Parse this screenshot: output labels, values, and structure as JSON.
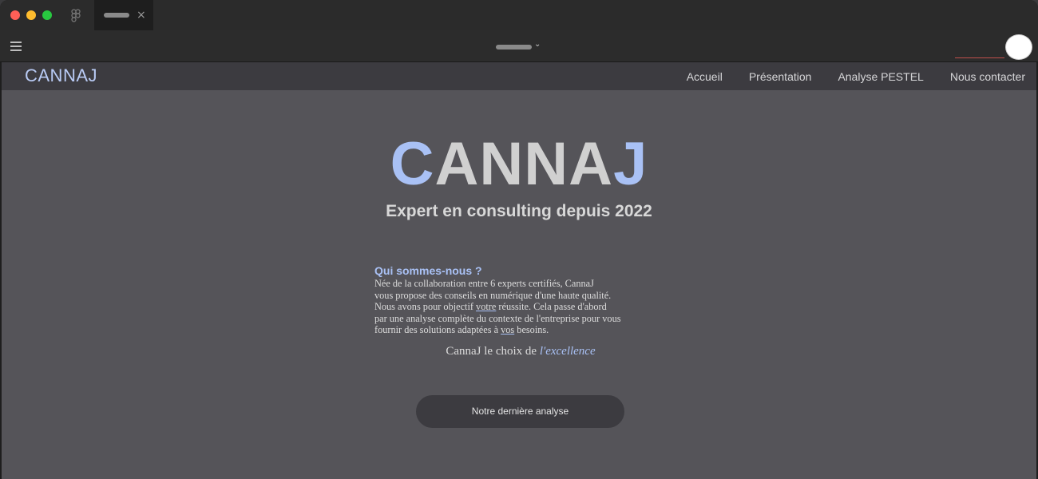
{
  "browser": {
    "tab_close_glyph": "×",
    "menu_chevron_glyph": "⌄"
  },
  "site": {
    "brand": "CANNAJ",
    "nav": [
      "Accueil",
      "Présentation",
      "Analyse PESTEL",
      "Nous contacter"
    ],
    "hero": {
      "title_first_letter": "C",
      "title_middle": "ANNA",
      "title_last_letter": "J",
      "subtitle": "Expert en consulting depuis 2022"
    },
    "about": {
      "heading": "Qui sommes-nous ?",
      "line1": "Née de la collaboration entre 6 experts certifiés, CannaJ",
      "line2": "vous propose des conseils en numérique d'une haute qualité.",
      "line3_pre": "Nous avons pour objectif ",
      "line3_u": "votre",
      "line3_post": " réussite. Cela passe d'abord",
      "line4": "par une analyse complète du contexte de l'entreprise pour vous",
      "line5_pre": "fournir des solutions adaptées à ",
      "line5_u": "vos",
      "line5_post": " besoins."
    },
    "tagline": {
      "text": "CannaJ le choix de ",
      "emphasis": "l'excellence"
    },
    "cta_label": "Notre dernière analyse"
  },
  "colors": {
    "accent": "#a9c1f5",
    "page_bg": "#555459",
    "nav_bg": "#3c3b40"
  }
}
